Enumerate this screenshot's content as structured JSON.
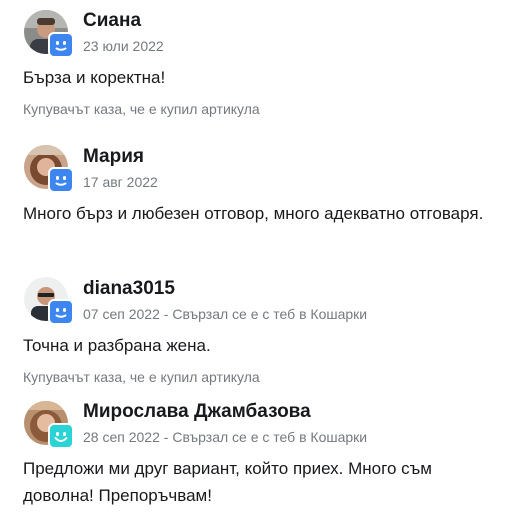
{
  "reviews": [
    {
      "name": "Сиана",
      "date": "23 юли 2022",
      "contact": "",
      "text": "Бърза и коректна!",
      "note": "Купувачът каза, че е купил артикула",
      "badge_color": "#3d86f0",
      "badge_icon": "neutral-face-icon"
    },
    {
      "name": "Мария",
      "date": "17 авг 2022",
      "contact": "",
      "text": "Много бърз и любезен отговор, много адекватно отговаря.",
      "note": "",
      "badge_color": "#3d86f0",
      "badge_icon": "neutral-face-icon"
    },
    {
      "name": "diana3015",
      "date": "07 сеп 2022",
      "contact": "Свързал се е с теб в Кошарки",
      "text": "Точна и разбрана жена.",
      "note": "Купувачът каза, че е купил артикула",
      "badge_color": "#3d86f0",
      "badge_icon": "neutral-face-icon"
    },
    {
      "name": "Мирослава Джамбазова",
      "date": "28 сеп 2022",
      "contact": "Свързал се е с теб в Кошарки",
      "text": "Предложи ми друг вариант, който приех. Много съм доволна! Препоръчвам!",
      "note": "",
      "badge_color": "#2ad4d4",
      "badge_icon": "happy-face-icon"
    }
  ],
  "separator": " - "
}
